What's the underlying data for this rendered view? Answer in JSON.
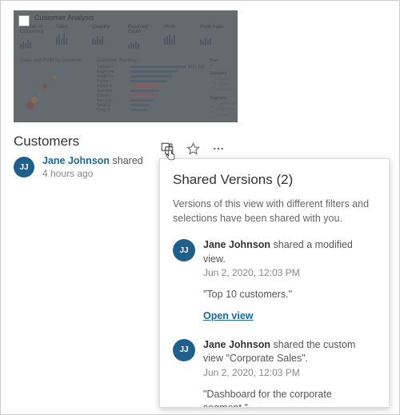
{
  "thumbnail": {
    "header": "Customer Analysis",
    "sparks": [
      {
        "label": "Number of Customers"
      },
      {
        "label": "Sales"
      },
      {
        "label": "Quantity"
      },
      {
        "label": "Returned Count"
      },
      {
        "label": "Profit"
      },
      {
        "label": "Profit Ratio"
      }
    ],
    "scatter_title": "Sales and Profit by Customer",
    "rank_title": "Customer Ranking",
    "side": {
      "year_label": "Year",
      "year_value": "All",
      "category_label": "Category",
      "category_items": [
        "Furniture",
        "Office",
        "Technol"
      ],
      "segment_label": "Segment",
      "segment_items": [
        "Consumer",
        "Corporate",
        "Home Of"
      ]
    }
  },
  "page": {
    "title": "Customers",
    "author": "Jane Johnson",
    "action": "shared",
    "time": "4 hours ago",
    "avatar": "JJ"
  },
  "actions": {
    "shared_views_tooltip": "Shared Versions",
    "star_tooltip": "Favorite",
    "more_tooltip": "More actions"
  },
  "popover": {
    "title": "Shared Versions (2)",
    "description": "Versions of this view with different filters and selections have been shared with you.",
    "open_label": "Open view",
    "items": [
      {
        "avatar": "JJ",
        "author": "Jane Johnson",
        "rest": " shared a modified view.",
        "timestamp": "Jun 2, 2020, 12:03 PM",
        "note": "\"Top 10 customers.\"",
        "show_open": true
      },
      {
        "avatar": "JJ",
        "author": "Jane Johnson",
        "rest": " shared the custom view \"Corporate Sales\".",
        "timestamp": "Jun 2, 2020, 12:03 PM",
        "note": "\"Dashboard for the corporate segment.\"",
        "show_open": false
      }
    ]
  }
}
